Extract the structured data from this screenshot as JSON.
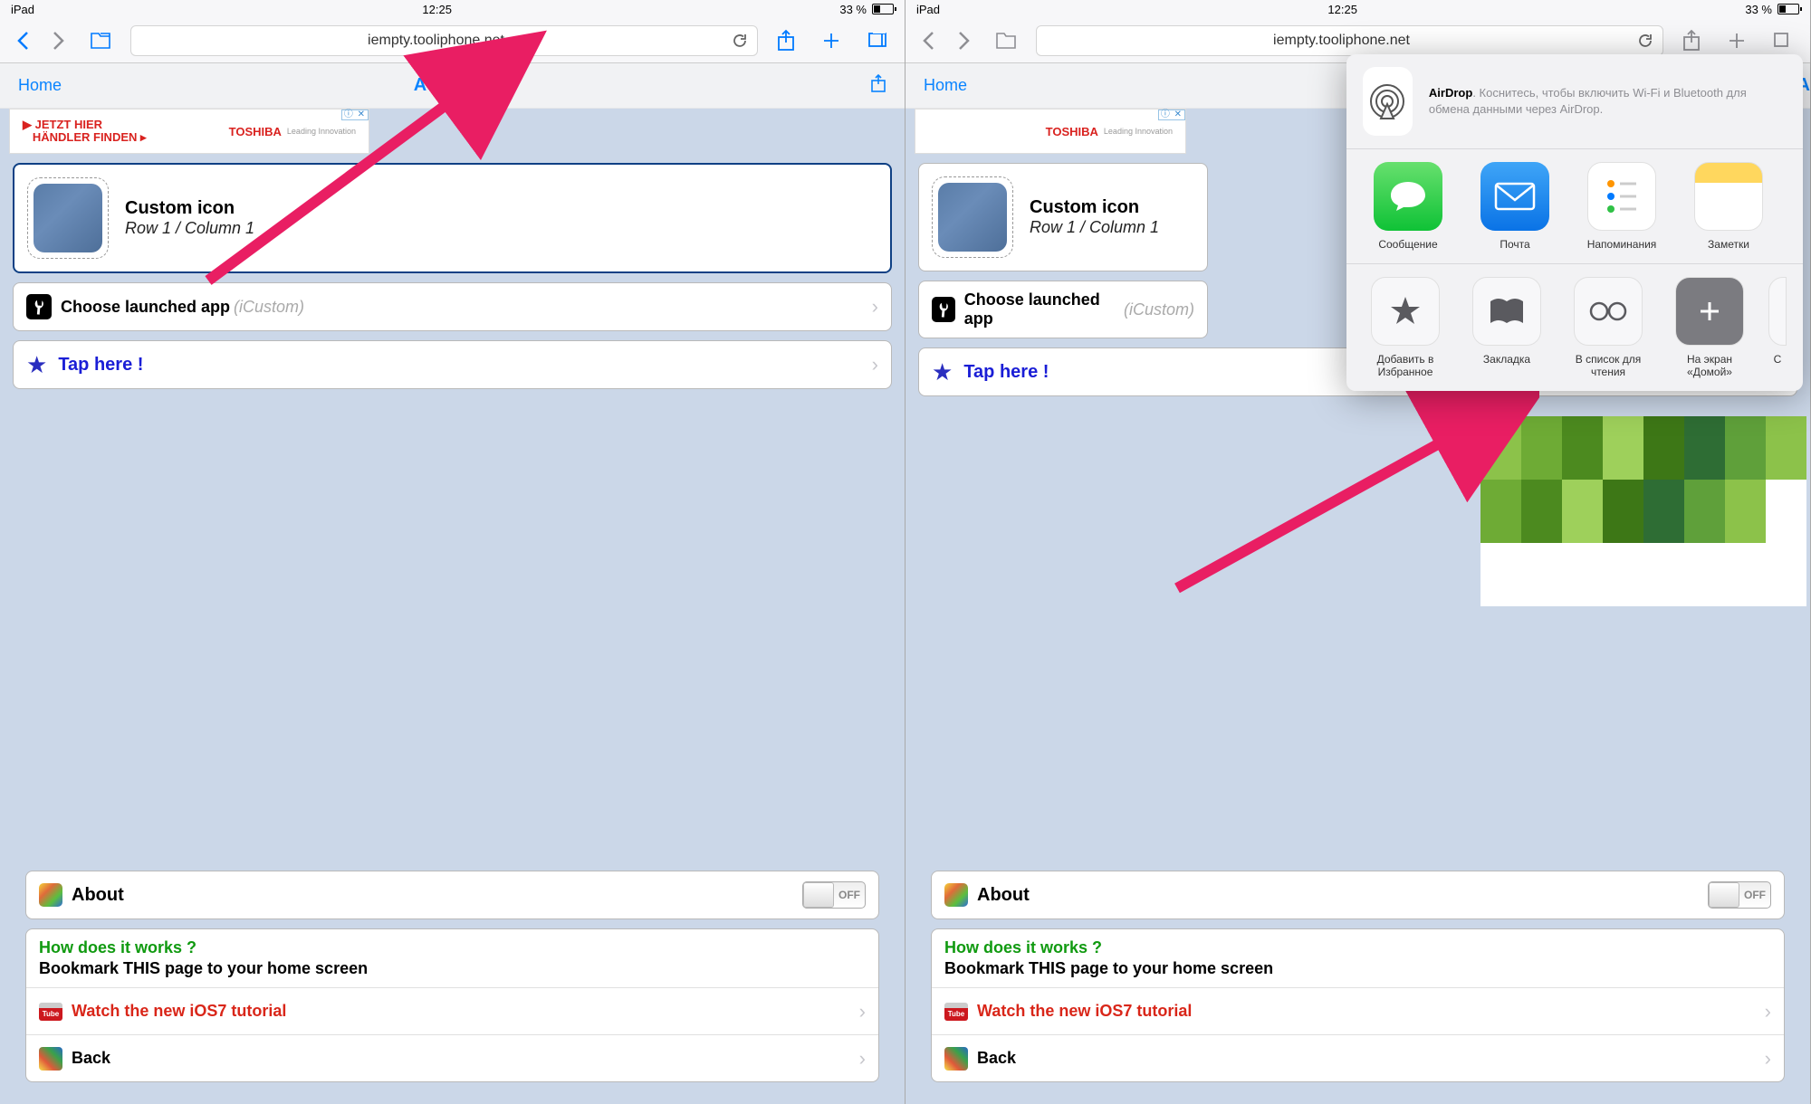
{
  "status": {
    "device": "iPad",
    "time": "12:25",
    "battery": "33 %"
  },
  "toolbar": {
    "url": "iempty.tooliphone.net"
  },
  "page": {
    "home": "Home",
    "title": "Add Icon",
    "ad": {
      "line1": "JETZT HIER",
      "line2": "HÄNDLER FINDEN",
      "brand": "TOSHIBA",
      "tagline": "Leading Innovation"
    },
    "custom": {
      "title": "Custom icon",
      "subtitle": "Row 1 / Column 1"
    },
    "launched": {
      "label": "Choose launched app",
      "hint": "(iCustom)"
    },
    "tap": "Tap here !",
    "about": {
      "label": "About",
      "toggle": "OFF"
    },
    "info": {
      "q": "How does it works ?",
      "bm": "Bookmark THIS page to your home screen",
      "watch": "Watch the new iOS7 tutorial",
      "back": "Back"
    }
  },
  "share": {
    "airdrop_name": "AirDrop",
    "airdrop_desc": ". Коснитесь, чтобы включить Wi-Fi и Bluetooth для обмена данными через AirDrop.",
    "apps": [
      {
        "label": "Сообщение"
      },
      {
        "label": "Почта"
      },
      {
        "label": "Напоминания"
      },
      {
        "label": "Заметки"
      }
    ],
    "actions": [
      {
        "label": "Добавить в Избранное"
      },
      {
        "label": "Закладка"
      },
      {
        "label": "В список для чтения"
      },
      {
        "label": "На экран «Домой»"
      }
    ]
  }
}
